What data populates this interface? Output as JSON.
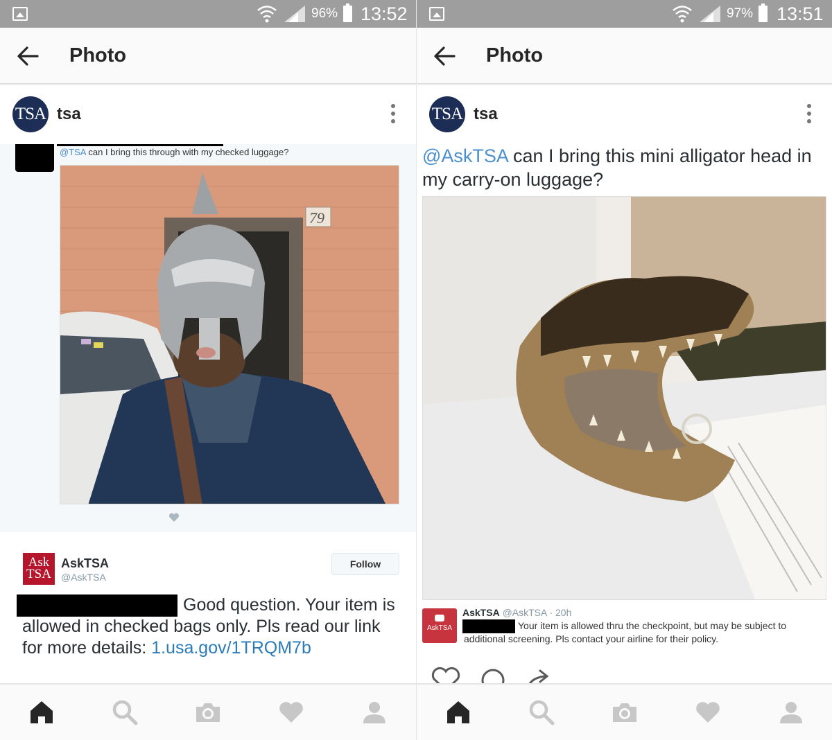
{
  "left": {
    "status": {
      "battery": "96%",
      "time": "13:52"
    },
    "appbar": {
      "title": "Photo"
    },
    "post": {
      "avatar_text": "TSA",
      "username": "tsa"
    },
    "tweet": {
      "mention": "@TSA",
      "text": " can I bring this through with my checked luggage?"
    },
    "reply": {
      "logo_line1": "Ask",
      "logo_line2": "TSA",
      "name": "AskTSA",
      "handle": "@AskTSA",
      "follow": "Follow",
      "body": "Good question. Your item is allowed in checked bags only. Pls read our link for more details: ",
      "link": "1.usa.gov/1TRQM7b"
    },
    "photo": {
      "house_number": "79"
    }
  },
  "right": {
    "status": {
      "battery": "97%",
      "time": "13:51"
    },
    "appbar": {
      "title": "Photo"
    },
    "post": {
      "avatar_text": "TSA",
      "username": "tsa"
    },
    "caption": {
      "mention": "@AskTSA",
      "text": " can I bring this mini alligator head in my carry-on luggage?"
    },
    "quote": {
      "icon_label": "AskTSA",
      "name": "AskTSA",
      "meta": " @AskTSA · 20h",
      "text": "Your item is allowed thru the checkpoint, but may be subject to additional screening. Pls contact your airline for their policy."
    }
  },
  "icons": [
    "gallery-icon",
    "wifi-icon",
    "signal-icon",
    "battery-icon",
    "back-arrow-icon",
    "more-vert-icon",
    "heart-icon",
    "comment-icon",
    "share-icon",
    "home-icon",
    "search-icon",
    "camera-icon",
    "activity-heart-icon",
    "profile-icon"
  ],
  "colors": {
    "mention": "#4b8fcc",
    "link": "#2b7bb9",
    "tsa_navy": "#1c2e55",
    "asktsa_red": "#b5162b"
  }
}
